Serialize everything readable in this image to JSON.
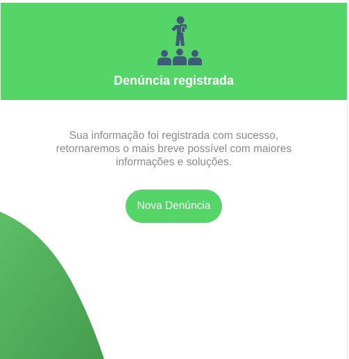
{
  "header": {
    "icon": "speaker-audience-icon",
    "title": "Denúncia registrada",
    "background_color": "#55d468",
    "icon_color": "#3f5a78"
  },
  "message": {
    "line1": "Sua informação foi registrada com sucesso,",
    "line2": "retornaremos o mais breve possível com maiores",
    "line3": "informações e soluções."
  },
  "actions": {
    "new_report_label": "Nova Denúncia",
    "button_color": "#55d468"
  },
  "decoration": {
    "shape": "green-curved-wave",
    "color": "#4fb45a"
  }
}
